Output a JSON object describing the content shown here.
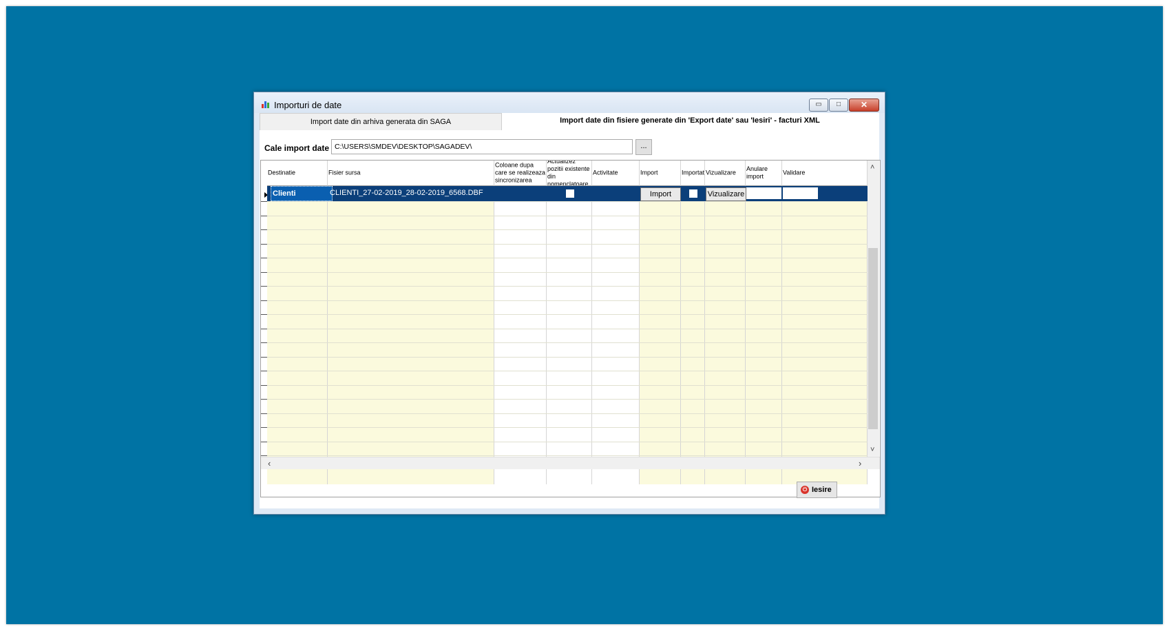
{
  "window": {
    "title": "Importuri de date",
    "controls": {
      "minimize": "▭",
      "maximize": "□",
      "close": "✕"
    }
  },
  "tabs": [
    {
      "label": "Import date din arhiva generata din SAGA"
    },
    {
      "label": "Import date din fisiere generate din 'Export date' sau 'Iesiri' - facturi XML"
    }
  ],
  "path": {
    "label": "Cale import date",
    "value": "C:\\USERS\\SMDEV\\DESKTOP\\SAGADEV\\",
    "browse_label": "..."
  },
  "grid": {
    "columns": [
      "Destinatie",
      "Fisier sursa",
      "Coloane dupa care se realizeaza sincronizarea",
      "Actualizez pozitii existente din nomenclatoare",
      "Activitate",
      "Import",
      "Importat",
      "Vizualizare",
      "Anulare import",
      "Validare"
    ],
    "rows": [
      {
        "destinatie": "Clienti",
        "fisier_sursa": "CLIENTI_27-02-2019_28-02-2019_6568.DBF",
        "import_button": "Import",
        "vizualizare_button": "Vizualizare"
      }
    ]
  },
  "footer": {
    "exit_label": "Iesire"
  },
  "colors": {
    "desktop": "#0073a4",
    "selected_row": "#0b3f7a",
    "yellow_cell": "#fbfadd"
  },
  "icons": {
    "app": "chart-icon",
    "exit": "power-icon"
  }
}
